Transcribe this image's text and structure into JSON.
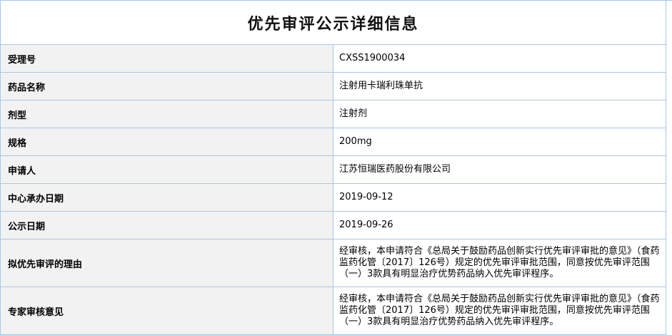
{
  "title": "优先审评公示详细信息",
  "rows": [
    {
      "label": "受理号",
      "value": "CXSS1900034"
    },
    {
      "label": "药品名称",
      "value": "注射用卡瑞利珠单抗"
    },
    {
      "label": "剂型",
      "value": "注射剂"
    },
    {
      "label": "规格",
      "value": "200mg"
    },
    {
      "label": "申请人",
      "value": "江苏恒瑞医药股份有限公司"
    },
    {
      "label": "中心承办日期",
      "value": "2019-09-12"
    },
    {
      "label": "公示日期",
      "value": "2019-09-26"
    },
    {
      "label": "拟优先审评的理由",
      "value": "经审核，本申请符合《总局关于鼓励药品创新实行优先审评审批的意见》（食药监药化管〔2017〕126号）规定的优先审评审批范围，同意按优先审评范围（一）3款具有明显治疗优势药品纳入优先审评程序。"
    },
    {
      "label": "专家审核意见",
      "value": "经审核，本申请符合《总局关于鼓励药品创新实行优先审评审批的意见》（食药监药化管〔2017〕126号）规定的优先审评审批范围，同意按优先审评范围（一）3款具有明显治疗优势药品纳入优先审评程序。"
    }
  ]
}
